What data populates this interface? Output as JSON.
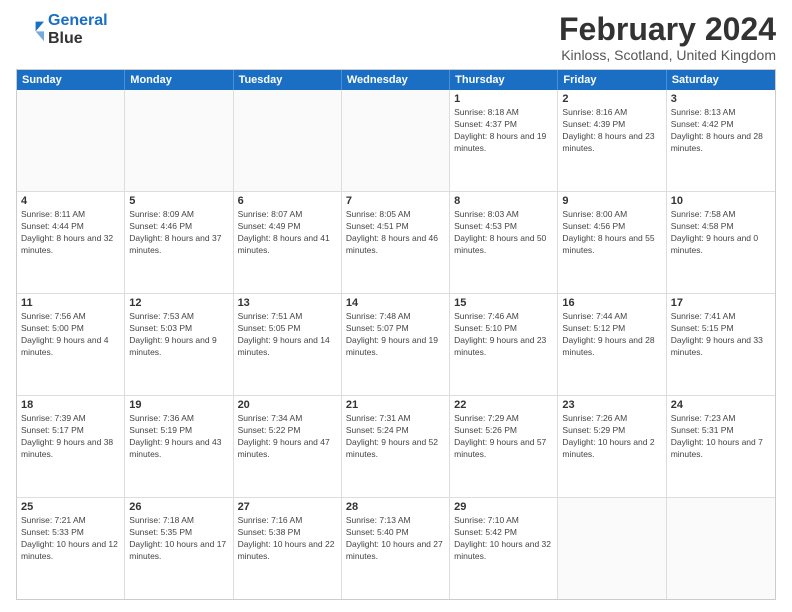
{
  "logo": {
    "line1": "General",
    "line2": "Blue"
  },
  "title": "February 2024",
  "location": "Kinloss, Scotland, United Kingdom",
  "headers": [
    "Sunday",
    "Monday",
    "Tuesday",
    "Wednesday",
    "Thursday",
    "Friday",
    "Saturday"
  ],
  "weeks": [
    [
      {
        "day": "",
        "sunrise": "",
        "sunset": "",
        "daylight": ""
      },
      {
        "day": "",
        "sunrise": "",
        "sunset": "",
        "daylight": ""
      },
      {
        "day": "",
        "sunrise": "",
        "sunset": "",
        "daylight": ""
      },
      {
        "day": "",
        "sunrise": "",
        "sunset": "",
        "daylight": ""
      },
      {
        "day": "1",
        "sunrise": "Sunrise: 8:18 AM",
        "sunset": "Sunset: 4:37 PM",
        "daylight": "Daylight: 8 hours and 19 minutes."
      },
      {
        "day": "2",
        "sunrise": "Sunrise: 8:16 AM",
        "sunset": "Sunset: 4:39 PM",
        "daylight": "Daylight: 8 hours and 23 minutes."
      },
      {
        "day": "3",
        "sunrise": "Sunrise: 8:13 AM",
        "sunset": "Sunset: 4:42 PM",
        "daylight": "Daylight: 8 hours and 28 minutes."
      }
    ],
    [
      {
        "day": "4",
        "sunrise": "Sunrise: 8:11 AM",
        "sunset": "Sunset: 4:44 PM",
        "daylight": "Daylight: 8 hours and 32 minutes."
      },
      {
        "day": "5",
        "sunrise": "Sunrise: 8:09 AM",
        "sunset": "Sunset: 4:46 PM",
        "daylight": "Daylight: 8 hours and 37 minutes."
      },
      {
        "day": "6",
        "sunrise": "Sunrise: 8:07 AM",
        "sunset": "Sunset: 4:49 PM",
        "daylight": "Daylight: 8 hours and 41 minutes."
      },
      {
        "day": "7",
        "sunrise": "Sunrise: 8:05 AM",
        "sunset": "Sunset: 4:51 PM",
        "daylight": "Daylight: 8 hours and 46 minutes."
      },
      {
        "day": "8",
        "sunrise": "Sunrise: 8:03 AM",
        "sunset": "Sunset: 4:53 PM",
        "daylight": "Daylight: 8 hours and 50 minutes."
      },
      {
        "day": "9",
        "sunrise": "Sunrise: 8:00 AM",
        "sunset": "Sunset: 4:56 PM",
        "daylight": "Daylight: 8 hours and 55 minutes."
      },
      {
        "day": "10",
        "sunrise": "Sunrise: 7:58 AM",
        "sunset": "Sunset: 4:58 PM",
        "daylight": "Daylight: 9 hours and 0 minutes."
      }
    ],
    [
      {
        "day": "11",
        "sunrise": "Sunrise: 7:56 AM",
        "sunset": "Sunset: 5:00 PM",
        "daylight": "Daylight: 9 hours and 4 minutes."
      },
      {
        "day": "12",
        "sunrise": "Sunrise: 7:53 AM",
        "sunset": "Sunset: 5:03 PM",
        "daylight": "Daylight: 9 hours and 9 minutes."
      },
      {
        "day": "13",
        "sunrise": "Sunrise: 7:51 AM",
        "sunset": "Sunset: 5:05 PM",
        "daylight": "Daylight: 9 hours and 14 minutes."
      },
      {
        "day": "14",
        "sunrise": "Sunrise: 7:48 AM",
        "sunset": "Sunset: 5:07 PM",
        "daylight": "Daylight: 9 hours and 19 minutes."
      },
      {
        "day": "15",
        "sunrise": "Sunrise: 7:46 AM",
        "sunset": "Sunset: 5:10 PM",
        "daylight": "Daylight: 9 hours and 23 minutes."
      },
      {
        "day": "16",
        "sunrise": "Sunrise: 7:44 AM",
        "sunset": "Sunset: 5:12 PM",
        "daylight": "Daylight: 9 hours and 28 minutes."
      },
      {
        "day": "17",
        "sunrise": "Sunrise: 7:41 AM",
        "sunset": "Sunset: 5:15 PM",
        "daylight": "Daylight: 9 hours and 33 minutes."
      }
    ],
    [
      {
        "day": "18",
        "sunrise": "Sunrise: 7:39 AM",
        "sunset": "Sunset: 5:17 PM",
        "daylight": "Daylight: 9 hours and 38 minutes."
      },
      {
        "day": "19",
        "sunrise": "Sunrise: 7:36 AM",
        "sunset": "Sunset: 5:19 PM",
        "daylight": "Daylight: 9 hours and 43 minutes."
      },
      {
        "day": "20",
        "sunrise": "Sunrise: 7:34 AM",
        "sunset": "Sunset: 5:22 PM",
        "daylight": "Daylight: 9 hours and 47 minutes."
      },
      {
        "day": "21",
        "sunrise": "Sunrise: 7:31 AM",
        "sunset": "Sunset: 5:24 PM",
        "daylight": "Daylight: 9 hours and 52 minutes."
      },
      {
        "day": "22",
        "sunrise": "Sunrise: 7:29 AM",
        "sunset": "Sunset: 5:26 PM",
        "daylight": "Daylight: 9 hours and 57 minutes."
      },
      {
        "day": "23",
        "sunrise": "Sunrise: 7:26 AM",
        "sunset": "Sunset: 5:29 PM",
        "daylight": "Daylight: 10 hours and 2 minutes."
      },
      {
        "day": "24",
        "sunrise": "Sunrise: 7:23 AM",
        "sunset": "Sunset: 5:31 PM",
        "daylight": "Daylight: 10 hours and 7 minutes."
      }
    ],
    [
      {
        "day": "25",
        "sunrise": "Sunrise: 7:21 AM",
        "sunset": "Sunset: 5:33 PM",
        "daylight": "Daylight: 10 hours and 12 minutes."
      },
      {
        "day": "26",
        "sunrise": "Sunrise: 7:18 AM",
        "sunset": "Sunset: 5:35 PM",
        "daylight": "Daylight: 10 hours and 17 minutes."
      },
      {
        "day": "27",
        "sunrise": "Sunrise: 7:16 AM",
        "sunset": "Sunset: 5:38 PM",
        "daylight": "Daylight: 10 hours and 22 minutes."
      },
      {
        "day": "28",
        "sunrise": "Sunrise: 7:13 AM",
        "sunset": "Sunset: 5:40 PM",
        "daylight": "Daylight: 10 hours and 27 minutes."
      },
      {
        "day": "29",
        "sunrise": "Sunrise: 7:10 AM",
        "sunset": "Sunset: 5:42 PM",
        "daylight": "Daylight: 10 hours and 32 minutes."
      },
      {
        "day": "",
        "sunrise": "",
        "sunset": "",
        "daylight": ""
      },
      {
        "day": "",
        "sunrise": "",
        "sunset": "",
        "daylight": ""
      }
    ]
  ]
}
